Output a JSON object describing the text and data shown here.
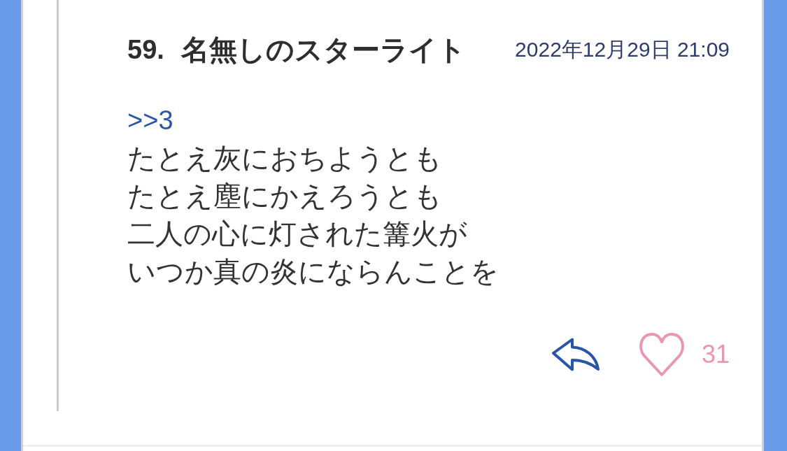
{
  "post": {
    "number": "59.",
    "author": "名無しのスターライト",
    "timestamp": "2022年12月29日 21:09",
    "reply_anchor": ">>3",
    "body_lines": [
      "たとえ灰におちようとも",
      "たとえ塵にかえろうとも",
      "二人の心に灯された篝火が",
      "いつか真の炎にならんことを"
    ],
    "likes": "31"
  }
}
